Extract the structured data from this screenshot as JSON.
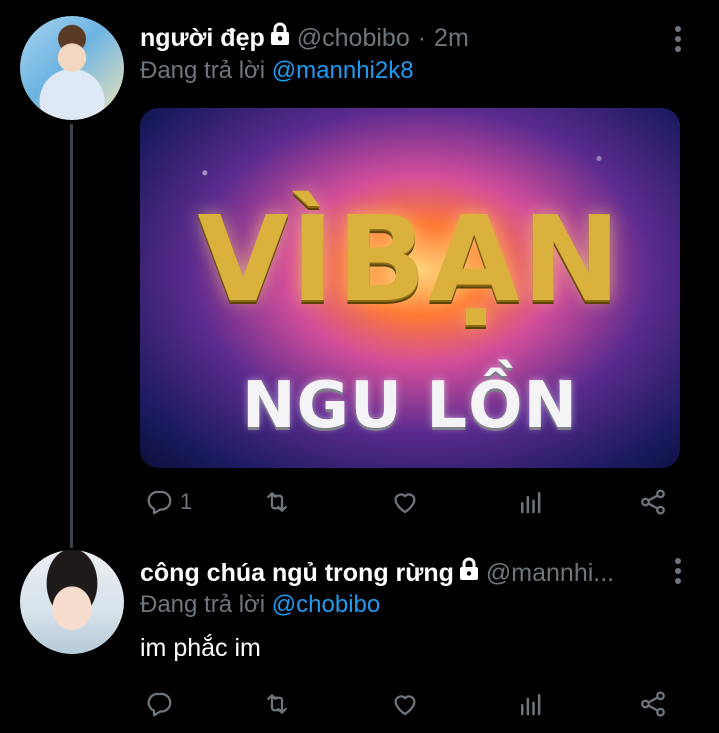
{
  "tweets": [
    {
      "display_name": "người đẹp",
      "handle": "@chobibo",
      "separator": "·",
      "time": "2m",
      "reply_prefix": "Đang trả lời",
      "reply_to": "@mannhi2k8",
      "media": {
        "big_text": "VÌBẠN",
        "small_text": "NGU LỒN"
      },
      "actions": {
        "reply_count": "1"
      }
    },
    {
      "display_name": "công chúa ngủ trong rừng",
      "handle": "@mannhi...",
      "reply_prefix": "Đang trả lời",
      "reply_to": "@chobibo",
      "text": "im phắc im",
      "actions": {
        "reply_count": ""
      }
    }
  ],
  "colors": {
    "background": "#000000",
    "secondary_text": "#6e767d",
    "accent": "#1d9bf0",
    "thread_line": "#3d4449"
  },
  "icons": [
    "lock-icon",
    "more-vertical-icon",
    "reply-icon",
    "retweet-icon",
    "like-icon",
    "analytics-icon",
    "share-icon"
  ]
}
